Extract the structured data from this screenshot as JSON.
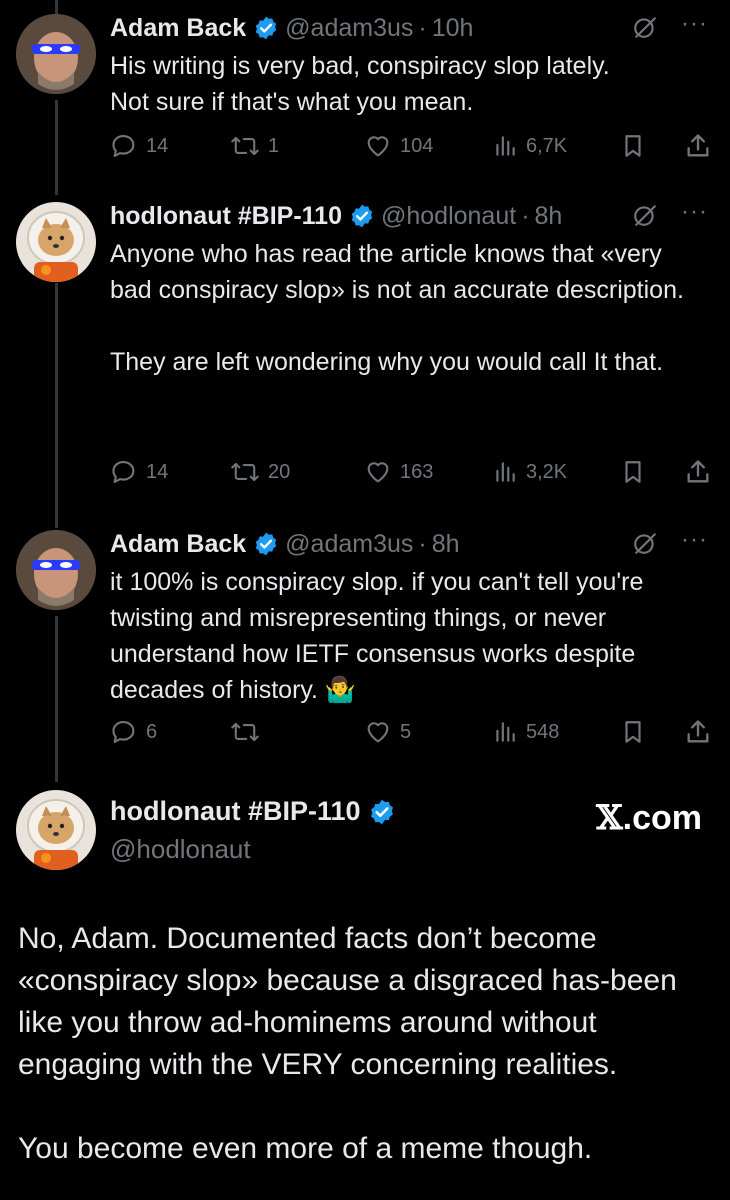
{
  "tweets": [
    {
      "name": "Adam Back",
      "handle": "@adam3us",
      "time": "10h",
      "text": "His writing is very bad, conspiracy slop lately.\nNot sure if that's what you mean.",
      "replies": "14",
      "reposts": "1",
      "likes": "104",
      "views": "6,7K"
    },
    {
      "name": "hodlonaut #BIP-110",
      "handle": "@hodlonaut",
      "time": "8h",
      "text": "Anyone who has read the article knows that «very bad conspiracy slop» is not an accurate description.\n\nThey are left wondering why you would call It that.",
      "replies": "14",
      "reposts": "20",
      "likes": "163",
      "views": "3,2K"
    },
    {
      "name": "Adam Back",
      "handle": "@adam3us",
      "time": "8h",
      "text": "it 100% is conspiracy slop. if you can't tell you're twisting and misrepresenting things, or never understand how IETF consensus works despite decades of history. 🤷‍♂️",
      "replies": "6",
      "reposts": "",
      "likes": "5",
      "views": "548"
    }
  ],
  "main_tweet": {
    "name": "hodlonaut #BIP-110",
    "handle": "@hodlonaut",
    "watermark_x": "𝕏",
    "watermark_rest": ".com",
    "text": "No, Adam. Documented facts don’t become «conspiracy slop» because a disgraced has-been like you throw ad-hominems around without engaging with the VERY concerning realities.\n\nYou become even more of a meme though."
  },
  "colors": {
    "background": "#000000",
    "text": "#e7e9ea",
    "muted": "#71767b",
    "verified": "#1d9bf0"
  },
  "icons": [
    "reply-icon",
    "repost-icon",
    "like-icon",
    "views-icon",
    "bookmark-icon",
    "share-icon",
    "verified-icon",
    "grok-icon",
    "more-icon"
  ]
}
